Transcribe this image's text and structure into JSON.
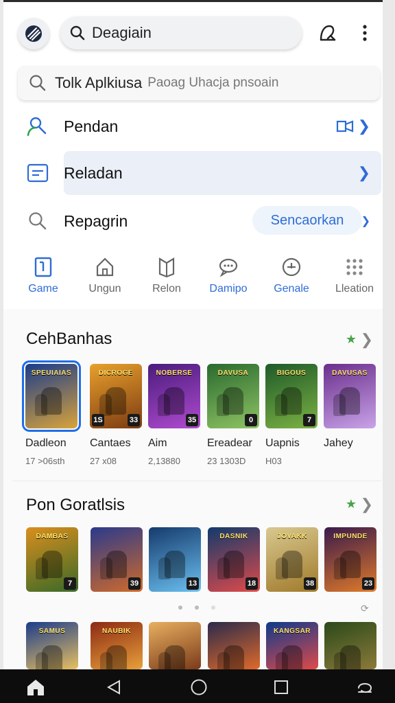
{
  "header": {
    "search_label": "Deagiain",
    "icons": [
      "brand-logo-icon",
      "search-icon",
      "profile-icon",
      "more-vertical-icon"
    ]
  },
  "search_box": {
    "value": "Tolk Aplkiusa",
    "placeholder": "Paoag Uhacja pnsoain"
  },
  "menu": {
    "rows": [
      {
        "label": "Pendan",
        "icon": "person-search-icon"
      },
      {
        "label": "Reladan",
        "icon": "list-icon"
      },
      {
        "label": "Repagrin",
        "icon": "search-icon",
        "pill": "Sencaorkan"
      }
    ]
  },
  "tabs": [
    {
      "label": "Game",
      "icon": "game-icon",
      "active": true
    },
    {
      "label": "Ungun",
      "icon": "home-icon",
      "active": false
    },
    {
      "label": "Relon",
      "icon": "book-icon",
      "active": false
    },
    {
      "label": "Damipo",
      "icon": "chat-icon",
      "active": false
    },
    {
      "label": "Genale",
      "icon": "plus-circle-icon",
      "active": false
    },
    {
      "label": "Lleation",
      "icon": "grid-icon",
      "active": false
    }
  ],
  "section1": {
    "title": "CehBanhas",
    "apps": [
      {
        "name": "Dadleon",
        "meta": "17 >06sth",
        "art": "SPEUIAIAS",
        "badge": "",
        "colors": [
          "#1b3c8c",
          "#d9a33a"
        ]
      },
      {
        "name": "Cantaes",
        "meta": "27 x08",
        "art": "DICROGE",
        "badge": "33",
        "badge2": "1S",
        "colors": [
          "#e8a02c",
          "#7c3b12"
        ]
      },
      {
        "name": "Aim",
        "meta": "2,13880",
        "art": "NOBERSE",
        "badge": "35",
        "colors": [
          "#4a1c7c",
          "#b04bd0"
        ]
      },
      {
        "name": "Ereadear",
        "meta": "23 1303D",
        "art": "DAVUSA",
        "badge": "0",
        "colors": [
          "#2a6a2f",
          "#8fc464"
        ]
      },
      {
        "name": "Uapnis",
        "meta": "H03",
        "art": "BIGOUS",
        "badge": "7",
        "colors": [
          "#1f5a2a",
          "#7cb243"
        ]
      },
      {
        "name": "Jahey",
        "meta": "",
        "art": "DAVUSAS",
        "badge": "",
        "colors": [
          "#6a2f8c",
          "#c9a3e8"
        ]
      }
    ]
  },
  "section2": {
    "title": "Pon Goratlsis",
    "apps": [
      {
        "art": "DAMBAS",
        "badge": "7",
        "colors": [
          "#d98e1e",
          "#3a6a27"
        ]
      },
      {
        "art": "",
        "badge": "39",
        "colors": [
          "#2a3a8c",
          "#d06a2a"
        ]
      },
      {
        "art": "",
        "badge": "13",
        "colors": [
          "#163a6c",
          "#6ac0f0"
        ]
      },
      {
        "art": "DASNIK",
        "badge": "18",
        "colors": [
          "#123a6c",
          "#e04a4a"
        ]
      },
      {
        "art": "JOVAKK",
        "badge": "38",
        "colors": [
          "#d8c890",
          "#a07a2a"
        ]
      },
      {
        "art": "IMPUNDE",
        "badge": "23",
        "colors": [
          "#3a1a4c",
          "#e07a2a"
        ]
      }
    ],
    "row3": [
      {
        "art": "SAMUS",
        "colors": [
          "#1b3c8c",
          "#e8c060"
        ]
      },
      {
        "art": "NAUBIK",
        "colors": [
          "#8c2a14",
          "#e8a03a"
        ]
      },
      {
        "art": "",
        "colors": [
          "#e8b060",
          "#7a3a1a"
        ]
      },
      {
        "art": "",
        "colors": [
          "#2a2a4c",
          "#e06a2a"
        ]
      },
      {
        "art": "KANGSAR",
        "colors": [
          "#0d3a8c",
          "#e04a4a"
        ]
      },
      {
        "art": "",
        "colors": [
          "#2a4a1a",
          "#8c7a3a"
        ]
      }
    ]
  },
  "colors": {
    "accent": "#2d6cd6",
    "highlight_row": "#ebeff8",
    "navbar": "#0d0d0d"
  }
}
